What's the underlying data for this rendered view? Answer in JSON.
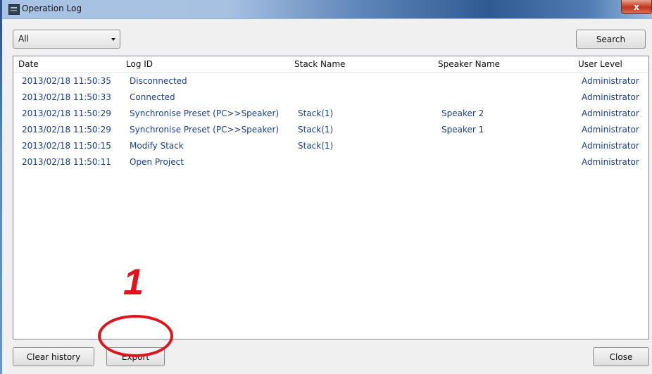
{
  "window": {
    "title": "Operation Log",
    "close_label": "x"
  },
  "filter": {
    "value": "All"
  },
  "buttons": {
    "search": "Search",
    "clear_history": "Clear history",
    "export": "Export",
    "close": "Close"
  },
  "columns": [
    "Date",
    "Log ID",
    "Stack Name",
    "Speaker Name",
    "User Level"
  ],
  "rows": [
    {
      "date": "2013/02/18 11:50:35",
      "log_id": "Disconnected",
      "stack": "",
      "speaker": "",
      "level": "Administrator"
    },
    {
      "date": "2013/02/18 11:50:33",
      "log_id": "Connected",
      "stack": "",
      "speaker": "",
      "level": "Administrator"
    },
    {
      "date": "2013/02/18 11:50:29",
      "log_id": "Synchronise Preset (PC>>Speaker)",
      "stack": "Stack(1)",
      "speaker": "Speaker 2",
      "level": "Administrator"
    },
    {
      "date": "2013/02/18 11:50:29",
      "log_id": "Synchronise Preset (PC>>Speaker)",
      "stack": "Stack(1)",
      "speaker": "Speaker 1",
      "level": "Administrator"
    },
    {
      "date": "2013/02/18 11:50:15",
      "log_id": "Modify Stack",
      "stack": "Stack(1)",
      "speaker": "",
      "level": "Administrator"
    },
    {
      "date": "2013/02/18 11:50:11",
      "log_id": "Open Project",
      "stack": "",
      "speaker": "",
      "level": "Administrator"
    }
  ],
  "annotation": {
    "number": "1",
    "color": "#e1141e"
  }
}
